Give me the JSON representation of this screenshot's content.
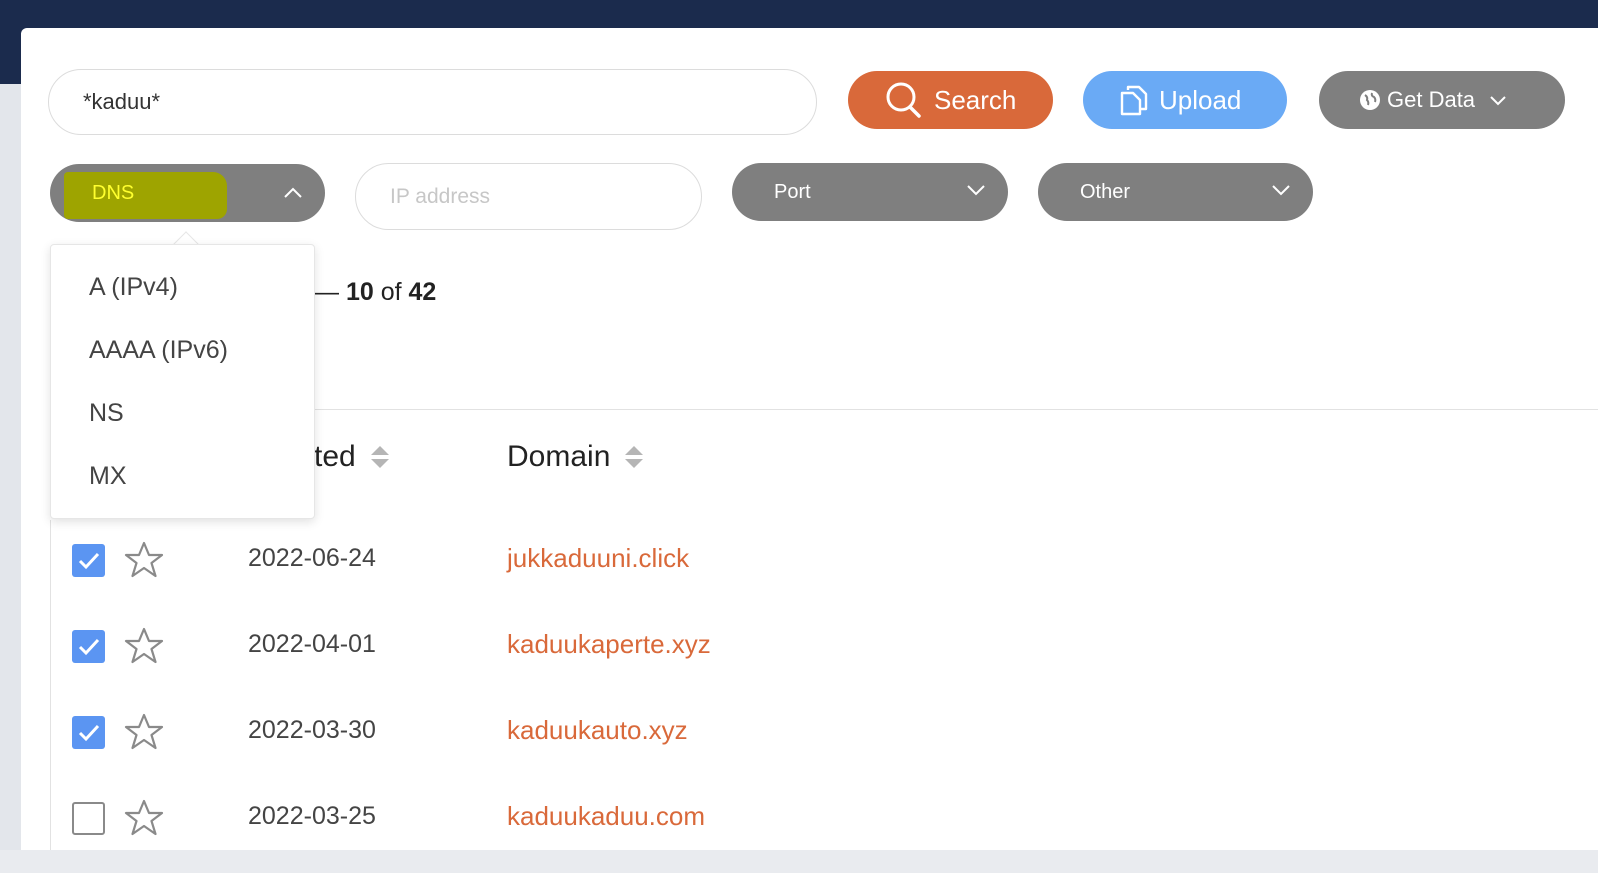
{
  "search": {
    "value": "*kaduu*",
    "button_label": "Search"
  },
  "upload": {
    "label": "Upload"
  },
  "get_data": {
    "label": "Get Data"
  },
  "filters": {
    "dns": "DNS",
    "ip_placeholder": "IP address",
    "port": "Port",
    "other": "Other"
  },
  "dns_options": [
    "A (IPv4)",
    "AAAA (IPv6)",
    "NS",
    "MX"
  ],
  "pagination": {
    "dash": "—",
    "to": "10",
    "of": "of",
    "total": "42"
  },
  "table": {
    "headers": {
      "created": "ted",
      "domain": "Domain"
    },
    "rows": [
      {
        "checked": true,
        "date": "2022-06-24",
        "domain": "jukkaduuni.click"
      },
      {
        "checked": true,
        "date": "2022-04-01",
        "domain": "kaduukaperte.xyz"
      },
      {
        "checked": true,
        "date": "2022-03-30",
        "domain": "kaduukauto.xyz"
      },
      {
        "checked": false,
        "date": "2022-03-25",
        "domain": "kaduukaduu.com"
      }
    ]
  },
  "colors": {
    "accent_orange": "#d9693a",
    "upload_blue": "#6aaaf5",
    "pill_gray": "#7f7f7f",
    "header_navy": "#1b2b4d",
    "dns_highlight": "#9ea400",
    "checkbox_blue": "#5b95f2"
  }
}
